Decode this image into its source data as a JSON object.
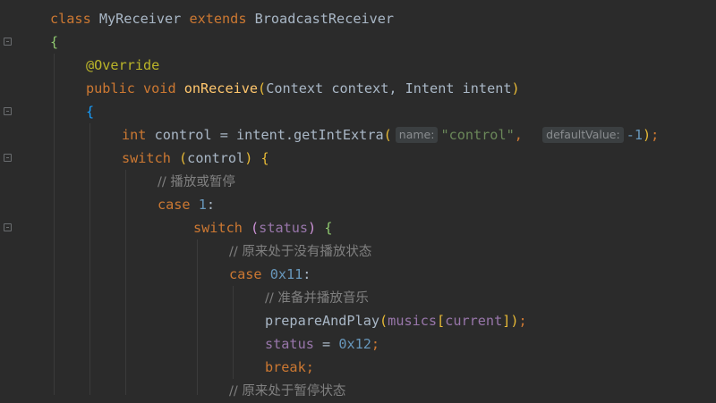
{
  "editor": {
    "lines": [
      {
        "indent": 0,
        "tokens": [
          {
            "t": "class ",
            "c": "kw"
          },
          {
            "t": "MyReceiver ",
            "c": "cls"
          },
          {
            "t": "extends ",
            "c": "kw"
          },
          {
            "t": "BroadcastReceiver",
            "c": "cls"
          }
        ]
      },
      {
        "indent": 0,
        "tokens": [
          {
            "t": "{",
            "c": "brg"
          }
        ]
      },
      {
        "indent": 1,
        "tokens": [
          {
            "t": "@Override",
            "c": "ann"
          }
        ]
      },
      {
        "indent": 1,
        "tokens": [
          {
            "t": "public ",
            "c": "kw"
          },
          {
            "t": "void ",
            "c": "kw"
          },
          {
            "t": "onReceive",
            "c": "fn"
          },
          {
            "t": "(",
            "c": "br1"
          },
          {
            "t": "Context context, Intent intent",
            "c": "cls"
          },
          {
            "t": ")",
            "c": "br1"
          }
        ]
      },
      {
        "indent": 1,
        "tokens": [
          {
            "t": "{",
            "c": "br3"
          }
        ]
      },
      {
        "indent": 2,
        "tokens": [
          {
            "t": "int ",
            "c": "kw"
          },
          {
            "t": "control = intent.getIntExtra",
            "c": "cls"
          },
          {
            "t": "(",
            "c": "br1"
          },
          {
            "t": "name:",
            "c": "hint"
          },
          {
            "t": "\"control\"",
            "c": "str"
          },
          {
            "t": ",  ",
            "c": "kw"
          },
          {
            "t": "defaultValue:",
            "c": "hint"
          },
          {
            "t": "-1",
            "c": "num"
          },
          {
            "t": ")",
            "c": "br1"
          },
          {
            "t": ";",
            "c": "kw"
          }
        ]
      },
      {
        "indent": 2,
        "tokens": [
          {
            "t": "switch ",
            "c": "kw"
          },
          {
            "t": "(",
            "c": "br1"
          },
          {
            "t": "control",
            "c": "cls"
          },
          {
            "t": ")",
            "c": "br1"
          },
          {
            "t": " ",
            "c": "cls"
          },
          {
            "t": "{",
            "c": "br1"
          }
        ]
      },
      {
        "indent": 3,
        "tokens": [
          {
            "t": "// 播放或暂停",
            "c": "cmt"
          }
        ]
      },
      {
        "indent": 3,
        "tokens": [
          {
            "t": "case ",
            "c": "kw"
          },
          {
            "t": "1",
            "c": "num"
          },
          {
            "t": ":",
            "c": "cls"
          }
        ]
      },
      {
        "indent": 4,
        "tokens": [
          {
            "t": "switch ",
            "c": "kw"
          },
          {
            "t": "(",
            "c": "br2"
          },
          {
            "t": "status",
            "c": "fld"
          },
          {
            "t": ")",
            "c": "br2"
          },
          {
            "t": " ",
            "c": "cls"
          },
          {
            "t": "{",
            "c": "brg"
          }
        ]
      },
      {
        "indent": 5,
        "tokens": [
          {
            "t": "// 原来处于没有播放状态",
            "c": "cmt"
          }
        ]
      },
      {
        "indent": 5,
        "tokens": [
          {
            "t": "case ",
            "c": "kw"
          },
          {
            "t": "0x11",
            "c": "num"
          },
          {
            "t": ":",
            "c": "cls"
          }
        ]
      },
      {
        "indent": 6,
        "tokens": [
          {
            "t": "// 准备并播放音乐",
            "c": "cmt"
          }
        ]
      },
      {
        "indent": 6,
        "tokens": [
          {
            "t": "prepareAndPlay",
            "c": "cls"
          },
          {
            "t": "(",
            "c": "br1"
          },
          {
            "t": "musics",
            "c": "fld"
          },
          {
            "t": "[",
            "c": "br1"
          },
          {
            "t": "current",
            "c": "fld"
          },
          {
            "t": "]",
            "c": "br1"
          },
          {
            "t": ")",
            "c": "br1"
          },
          {
            "t": ";",
            "c": "kw"
          }
        ]
      },
      {
        "indent": 6,
        "tokens": [
          {
            "t": "status ",
            "c": "fld"
          },
          {
            "t": "= ",
            "c": "cls"
          },
          {
            "t": "0x12",
            "c": "num"
          },
          {
            "t": ";",
            "c": "kw"
          }
        ]
      },
      {
        "indent": 6,
        "tokens": [
          {
            "t": "break",
            "c": "kw"
          },
          {
            "t": ";",
            "c": "kw"
          }
        ]
      },
      {
        "indent": 5,
        "tokens": [
          {
            "t": "// 原来处于暂停状态",
            "c": "cmt"
          }
        ]
      }
    ]
  }
}
